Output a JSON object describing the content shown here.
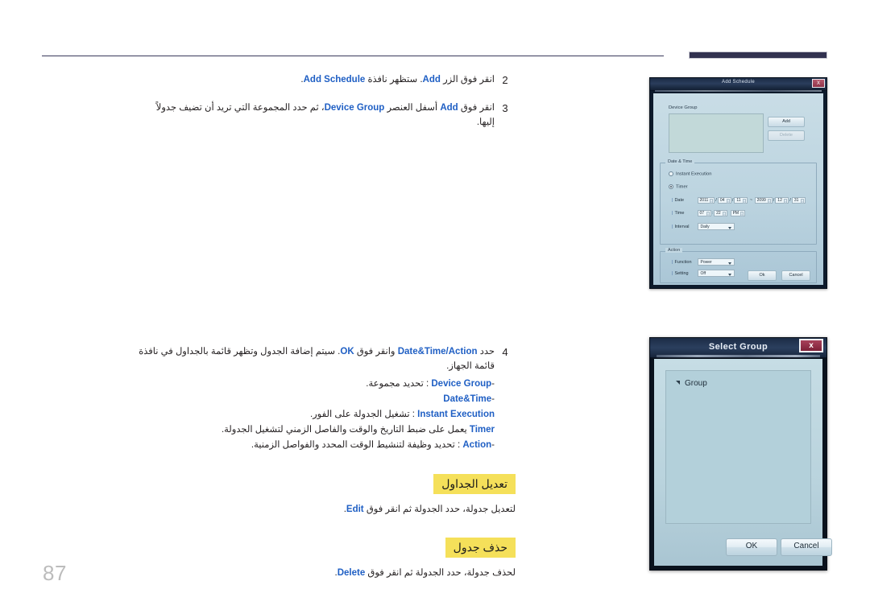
{
  "page": {
    "number": "87"
  },
  "steps": [
    {
      "num": "2",
      "html_parts": [
        {
          "t": "انقر فوق الزر ",
          "b": false
        },
        {
          "t": "Add",
          "b": true
        },
        {
          "t": ". ستظهر نافذة ",
          "b": false
        },
        {
          "t": "Add Schedule",
          "b": true
        },
        {
          "t": ".",
          "b": false
        }
      ]
    },
    {
      "num": "3",
      "html_parts": [
        {
          "t": "انقر فوق ",
          "b": false
        },
        {
          "t": "Add",
          "b": true
        },
        {
          "t": " أسفل العنصر ",
          "b": false
        },
        {
          "t": "Device Group",
          "b": true
        },
        {
          "t": "، ثم حدد المجموعة التي تريد أن تضيف جدولاً إليها.",
          "b": false
        }
      ]
    },
    {
      "num": "4",
      "html_parts": [
        {
          "t": "حدد ",
          "b": false
        },
        {
          "t": "Date&Time/Action",
          "b": true
        },
        {
          "t": " وانقر فوق ",
          "b": false
        },
        {
          "t": "OK",
          "b": true
        },
        {
          "t": ". سيتم إضافة الجدول وتظهر قائمة بالجداول في نافذة قائمة الجهاز.",
          "b": false
        }
      ],
      "sub_items": [
        [
          {
            "t": "-",
            "b": false
          },
          {
            "t": "Device Group",
            "b": true
          },
          {
            "t": " : تحديد مجموعة.",
            "b": false
          }
        ],
        [
          {
            "t": "-",
            "b": false
          },
          {
            "t": "Date&Time",
            "b": true
          }
        ],
        [
          {
            "t": "Instant Execution",
            "b": true
          },
          {
            "t": " : تشغيل الجدولة على الفور.",
            "b": false
          }
        ],
        [
          {
            "t": "Timer",
            "b": true
          },
          {
            "t": " يعمل على ضبط التاريخ والوقت والفاصل الزمني لتشغيل الجدولة.",
            "b": false
          }
        ],
        [
          {
            "t": "-",
            "b": false
          },
          {
            "t": "Action",
            "b": true
          },
          {
            "t": " : تحديد وظيفة لتنشيط الوقت المحدد والفواصل الزمنية.",
            "b": false
          }
        ]
      ]
    }
  ],
  "sections": [
    {
      "title": "تعديل الجداول",
      "body_parts": [
        {
          "t": "لتعديل جدولة، حدد الجدولة ثم انقر فوق ",
          "b": false
        },
        {
          "t": "Edit",
          "b": true
        },
        {
          "t": ".",
          "b": false
        }
      ]
    },
    {
      "title": "حذف جدول",
      "body_parts": [
        {
          "t": "لحذف جدولة، حدد الجدولة ثم انقر فوق ",
          "b": false
        },
        {
          "t": "Delete",
          "b": true
        },
        {
          "t": ".",
          "b": false
        }
      ]
    }
  ],
  "add_schedule_dialog": {
    "title": "Add Schedule",
    "close_label": "X",
    "device_group": {
      "label": "Device Group",
      "add_button": "Add",
      "delete_button": "Delete"
    },
    "date_time": {
      "group_label": "Date & Time",
      "instant_execution": "Instant Execution",
      "timer": "Timer",
      "date_label": "Date",
      "date_start": {
        "year": "2011",
        "month": "04",
        "day": "11"
      },
      "range_separator": "~",
      "date_end": {
        "year": "2099",
        "month": "12",
        "day": "31"
      },
      "time_label": "Time",
      "time": {
        "hour": "07",
        "minute": "22",
        "meridiem": "PM"
      },
      "interval_label": "Interval",
      "interval_value": "Daily"
    },
    "action": {
      "group_label": "Action",
      "function_label": "Function",
      "function_value": "Power",
      "setting_label": "Setting",
      "setting_value": "Off"
    },
    "ok_button": "Ok",
    "cancel_button": "Cancel"
  },
  "select_group_dialog": {
    "title": "Select Group",
    "close_label": "x",
    "tree_root": "Group",
    "ok_button": "OK",
    "cancel_button": "Cancel"
  },
  "colors": {
    "link_blue": "#1f5fc4",
    "highlight_yellow": "#f5e05a",
    "rule_navy": "#323250",
    "page_number_gray": "#bcbcbc"
  }
}
